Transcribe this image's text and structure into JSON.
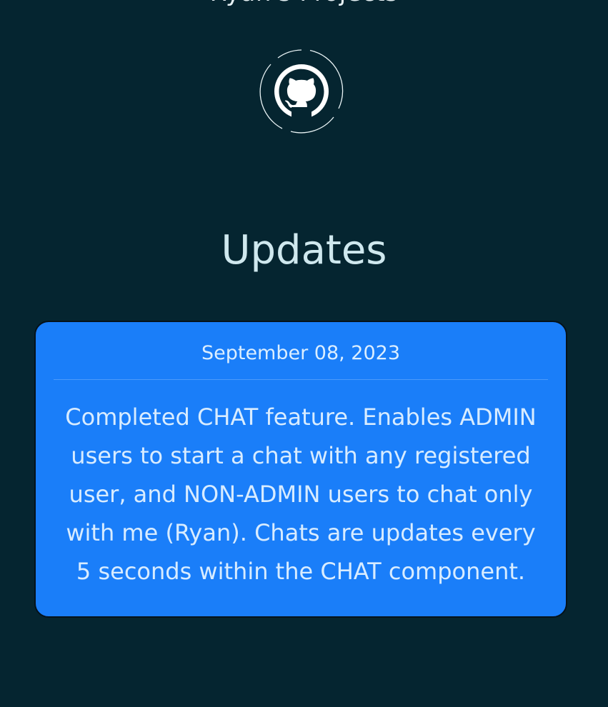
{
  "header": {
    "partial_text": "Ryan's Projects"
  },
  "social": {
    "github_icon": "github-icon"
  },
  "updates": {
    "title": "Updates",
    "items": [
      {
        "date": "September 08, 2023",
        "body": "Completed CHAT feature. Enables ADMIN users to start a chat with any registered user, and NON-ADMIN users to chat only with me (Ryan). Chats are updates every 5 seconds within the CHAT component."
      }
    ]
  },
  "colors": {
    "background": "#052530",
    "card": "#1a7ef9",
    "title_text": "#cfe8ee",
    "card_text": "#d8ecff"
  }
}
